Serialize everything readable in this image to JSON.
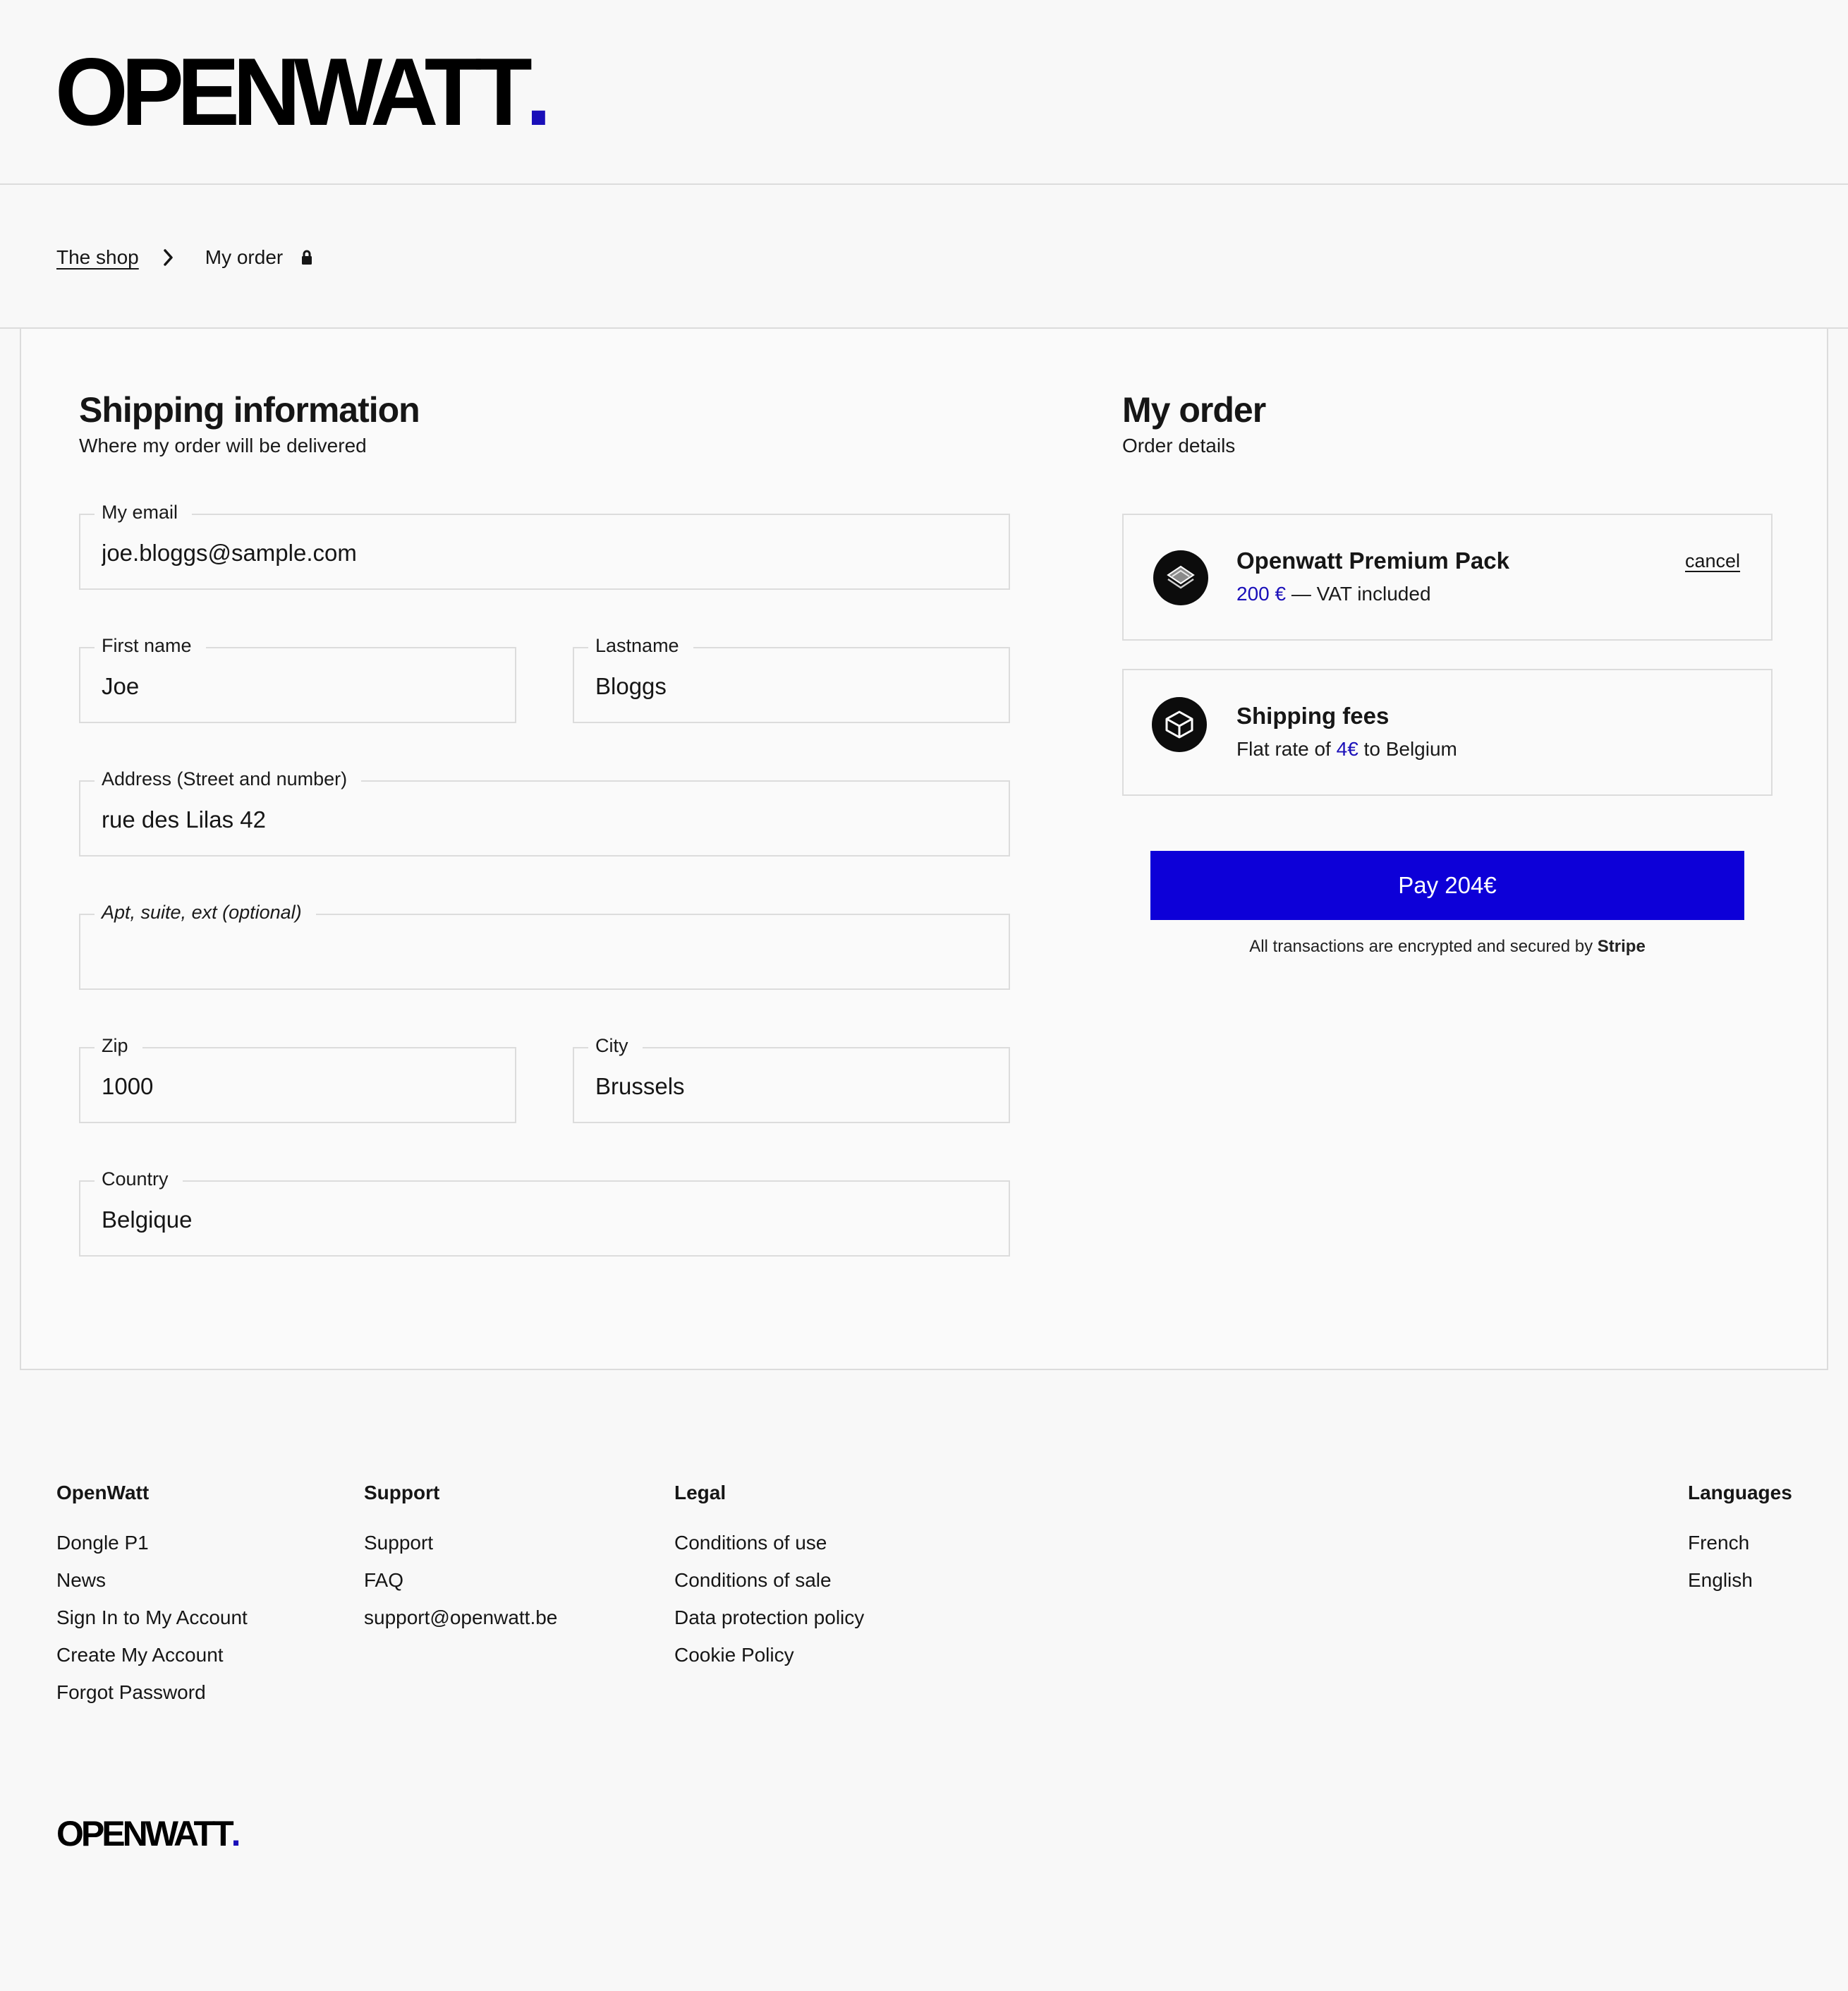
{
  "brand": {
    "logo_text": "OPENWATT",
    "logo_dot": ".",
    "accent_color": "#1a0fb9",
    "pay_button_color": "#0d00d8"
  },
  "breadcrumb": {
    "shop_label": "The shop",
    "current_label": "My order",
    "separator_icon": "chevron-right-icon",
    "secure_icon": "lock-icon"
  },
  "shipping": {
    "title": "Shipping information",
    "subtitle": "Where my order will be delivered",
    "fields": {
      "email": {
        "label": "My email",
        "value": "joe.bloggs@sample.com"
      },
      "first_name": {
        "label": "First name",
        "value": "Joe"
      },
      "last_name": {
        "label": "Lastname",
        "value": "Bloggs"
      },
      "address": {
        "label": "Address (Street and number)",
        "value": "rue des Lilas 42"
      },
      "apt": {
        "label": "Apt, suite, ext (optional)",
        "value": ""
      },
      "zip": {
        "label": "Zip",
        "value": "1000"
      },
      "city": {
        "label": "City",
        "value": "Brussels"
      },
      "country": {
        "label": "Country",
        "value": "Belgique"
      }
    }
  },
  "order": {
    "title": "My order",
    "subtitle": "Order details",
    "product": {
      "icon": "package-layers-icon",
      "name": "Openwatt Premium Pack",
      "price": "200 €",
      "price_suffix": " — VAT included",
      "cancel_label": "cancel"
    },
    "shipping_fees": {
      "icon": "box-icon",
      "name": "Shipping fees",
      "prefix": "Flat rate of ",
      "amount": "4€",
      "suffix": " to Belgium"
    },
    "pay_label": "Pay 204€",
    "secure_note_prefix": "All transactions are encrypted and secured by ",
    "secure_note_brand": "Stripe"
  },
  "footer": {
    "columns": [
      {
        "heading": "OpenWatt",
        "links": [
          "Dongle P1",
          "News",
          "Sign In to My Account",
          "Create My Account",
          "Forgot Password"
        ]
      },
      {
        "heading": "Support",
        "links": [
          "Support",
          "FAQ",
          "support@openwatt.be"
        ]
      },
      {
        "heading": "Legal",
        "links": [
          "Conditions of use",
          "Conditions of sale",
          "Data protection policy",
          "Cookie Policy"
        ]
      },
      {
        "heading": "Languages",
        "links": [
          "French",
          "English"
        ]
      }
    ],
    "logo_text": "OPENWATT",
    "logo_dot": "."
  }
}
